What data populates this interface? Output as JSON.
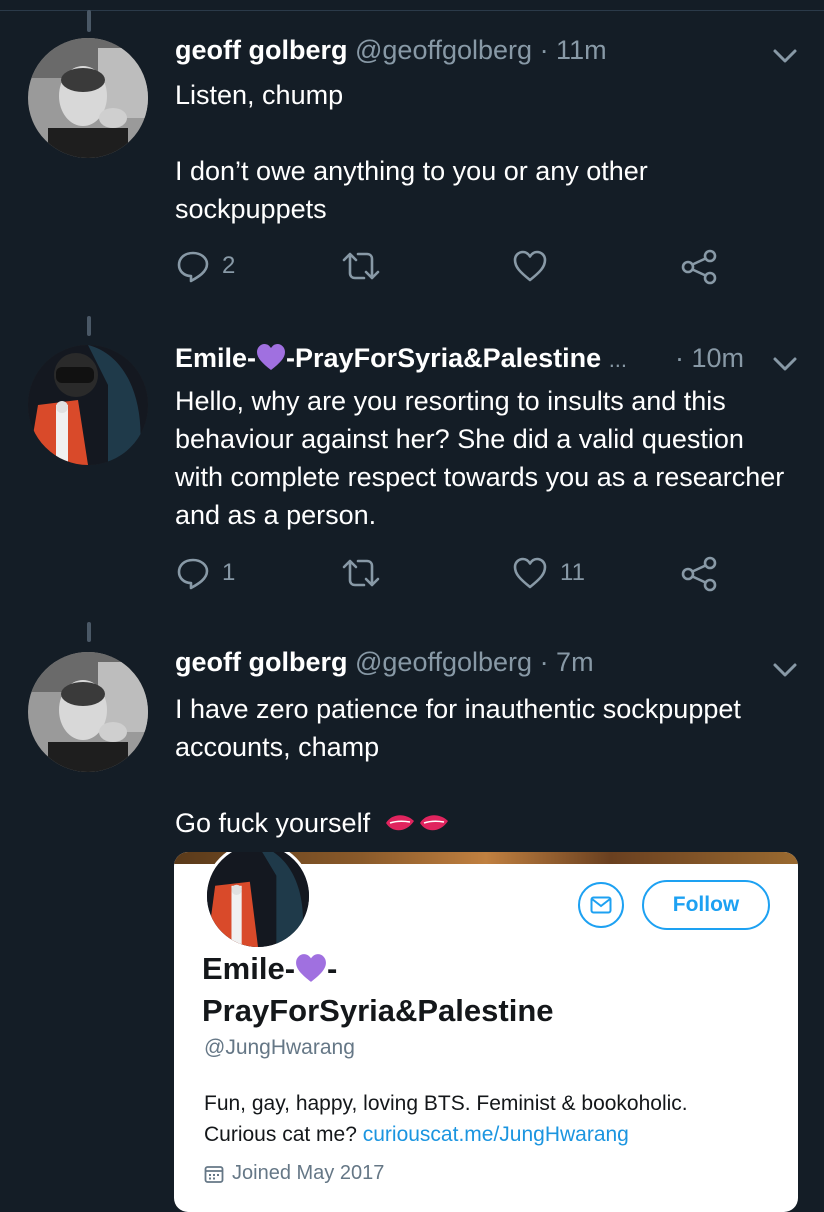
{
  "colors": {
    "background": "#141d26",
    "text": "#ffffff",
    "muted": "#8899a6",
    "accent": "#1da1f2",
    "heart_purple": "#a070e0"
  },
  "tweets": [
    {
      "name": "geoff golberg",
      "handle": "@geoffgolberg",
      "time": "· 11m",
      "body": [
        "Listen, chump",
        "I don’t owe anything to you or any other sockpuppets"
      ],
      "replies": "2",
      "retweets": "",
      "likes": ""
    },
    {
      "name_pre": "Emile-",
      "name_post": "-PrayForSyria&Palestine",
      "name_ellipsis": "...",
      "time": "· 10m",
      "body": [
        "Hello, why are you resorting to insults and this behaviour against her? She did a valid question with complete respect towards you as a researcher and as a person."
      ],
      "replies": "1",
      "retweets": "",
      "likes": "11"
    },
    {
      "name": "geoff golberg",
      "handle": "@geoffgolberg",
      "time": "· 7m",
      "body": [
        "I have zero patience for inauthentic sockpuppet accounts, champ",
        "Go fuck yourself"
      ]
    }
  ],
  "card": {
    "name_pre": "Emile-",
    "name_post": "-",
    "name_line2": "PrayForSyria&Palestine",
    "handle": "@JungHwarang",
    "bio_line1": "Fun, gay, happy, loving BTS. Feminist & bookoholic.",
    "bio_line2_prefix": "Curious cat me? ",
    "bio_link": "curiouscat.me/JungHwarang",
    "joined": "Joined May 2017",
    "follow_label": "Follow"
  }
}
